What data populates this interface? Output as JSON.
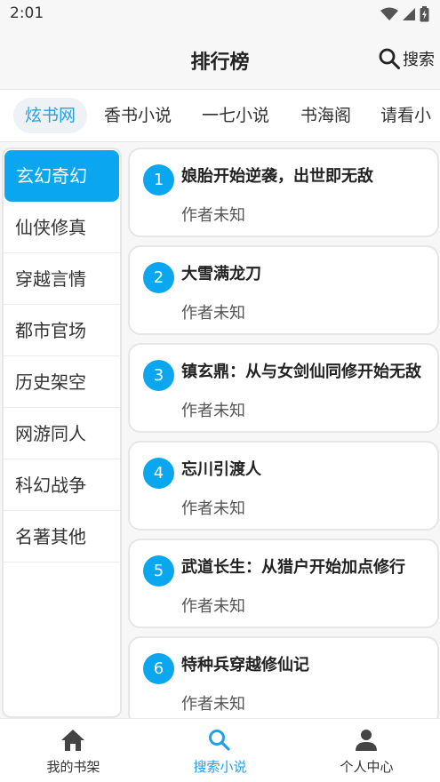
{
  "status_bar": {
    "time": "2:01"
  },
  "header": {
    "title": "排行榜",
    "search_label": "搜索"
  },
  "source_tabs": [
    {
      "label": "炫书网",
      "active": true
    },
    {
      "label": "香书小说",
      "active": false
    },
    {
      "label": "一七小说",
      "active": false
    },
    {
      "label": "书海阁",
      "active": false
    },
    {
      "label": "请看小",
      "active": false
    }
  ],
  "categories": [
    {
      "label": "玄幻奇幻",
      "active": true
    },
    {
      "label": "仙侠修真",
      "active": false
    },
    {
      "label": "穿越言情",
      "active": false
    },
    {
      "label": "都市官场",
      "active": false
    },
    {
      "label": "历史架空",
      "active": false
    },
    {
      "label": "网游同人",
      "active": false
    },
    {
      "label": "科幻战争",
      "active": false
    },
    {
      "label": "名著其他",
      "active": false
    }
  ],
  "books": [
    {
      "rank": "1",
      "title": "娘胎开始逆袭，出世即无敌",
      "author": "作者未知"
    },
    {
      "rank": "2",
      "title": "大雪满龙刀",
      "author": "作者未知"
    },
    {
      "rank": "3",
      "title": "镇玄鼎：从与女剑仙同修开始无敌",
      "author": "作者未知"
    },
    {
      "rank": "4",
      "title": "忘川引渡人",
      "author": "作者未知"
    },
    {
      "rank": "5",
      "title": "武道长生：从猎户开始加点修行",
      "author": "作者未知"
    },
    {
      "rank": "6",
      "title": "特种兵穿越修仙记",
      "author": "作者未知"
    }
  ],
  "bottom_nav": [
    {
      "label": "我的书架",
      "icon": "home-icon",
      "active": false
    },
    {
      "label": "搜索小说",
      "icon": "search-icon",
      "active": true
    },
    {
      "label": "个人中心",
      "icon": "person-icon",
      "active": false
    }
  ],
  "colors": {
    "accent": "#0aa6f0",
    "accent_text": "#1fa1ea"
  }
}
